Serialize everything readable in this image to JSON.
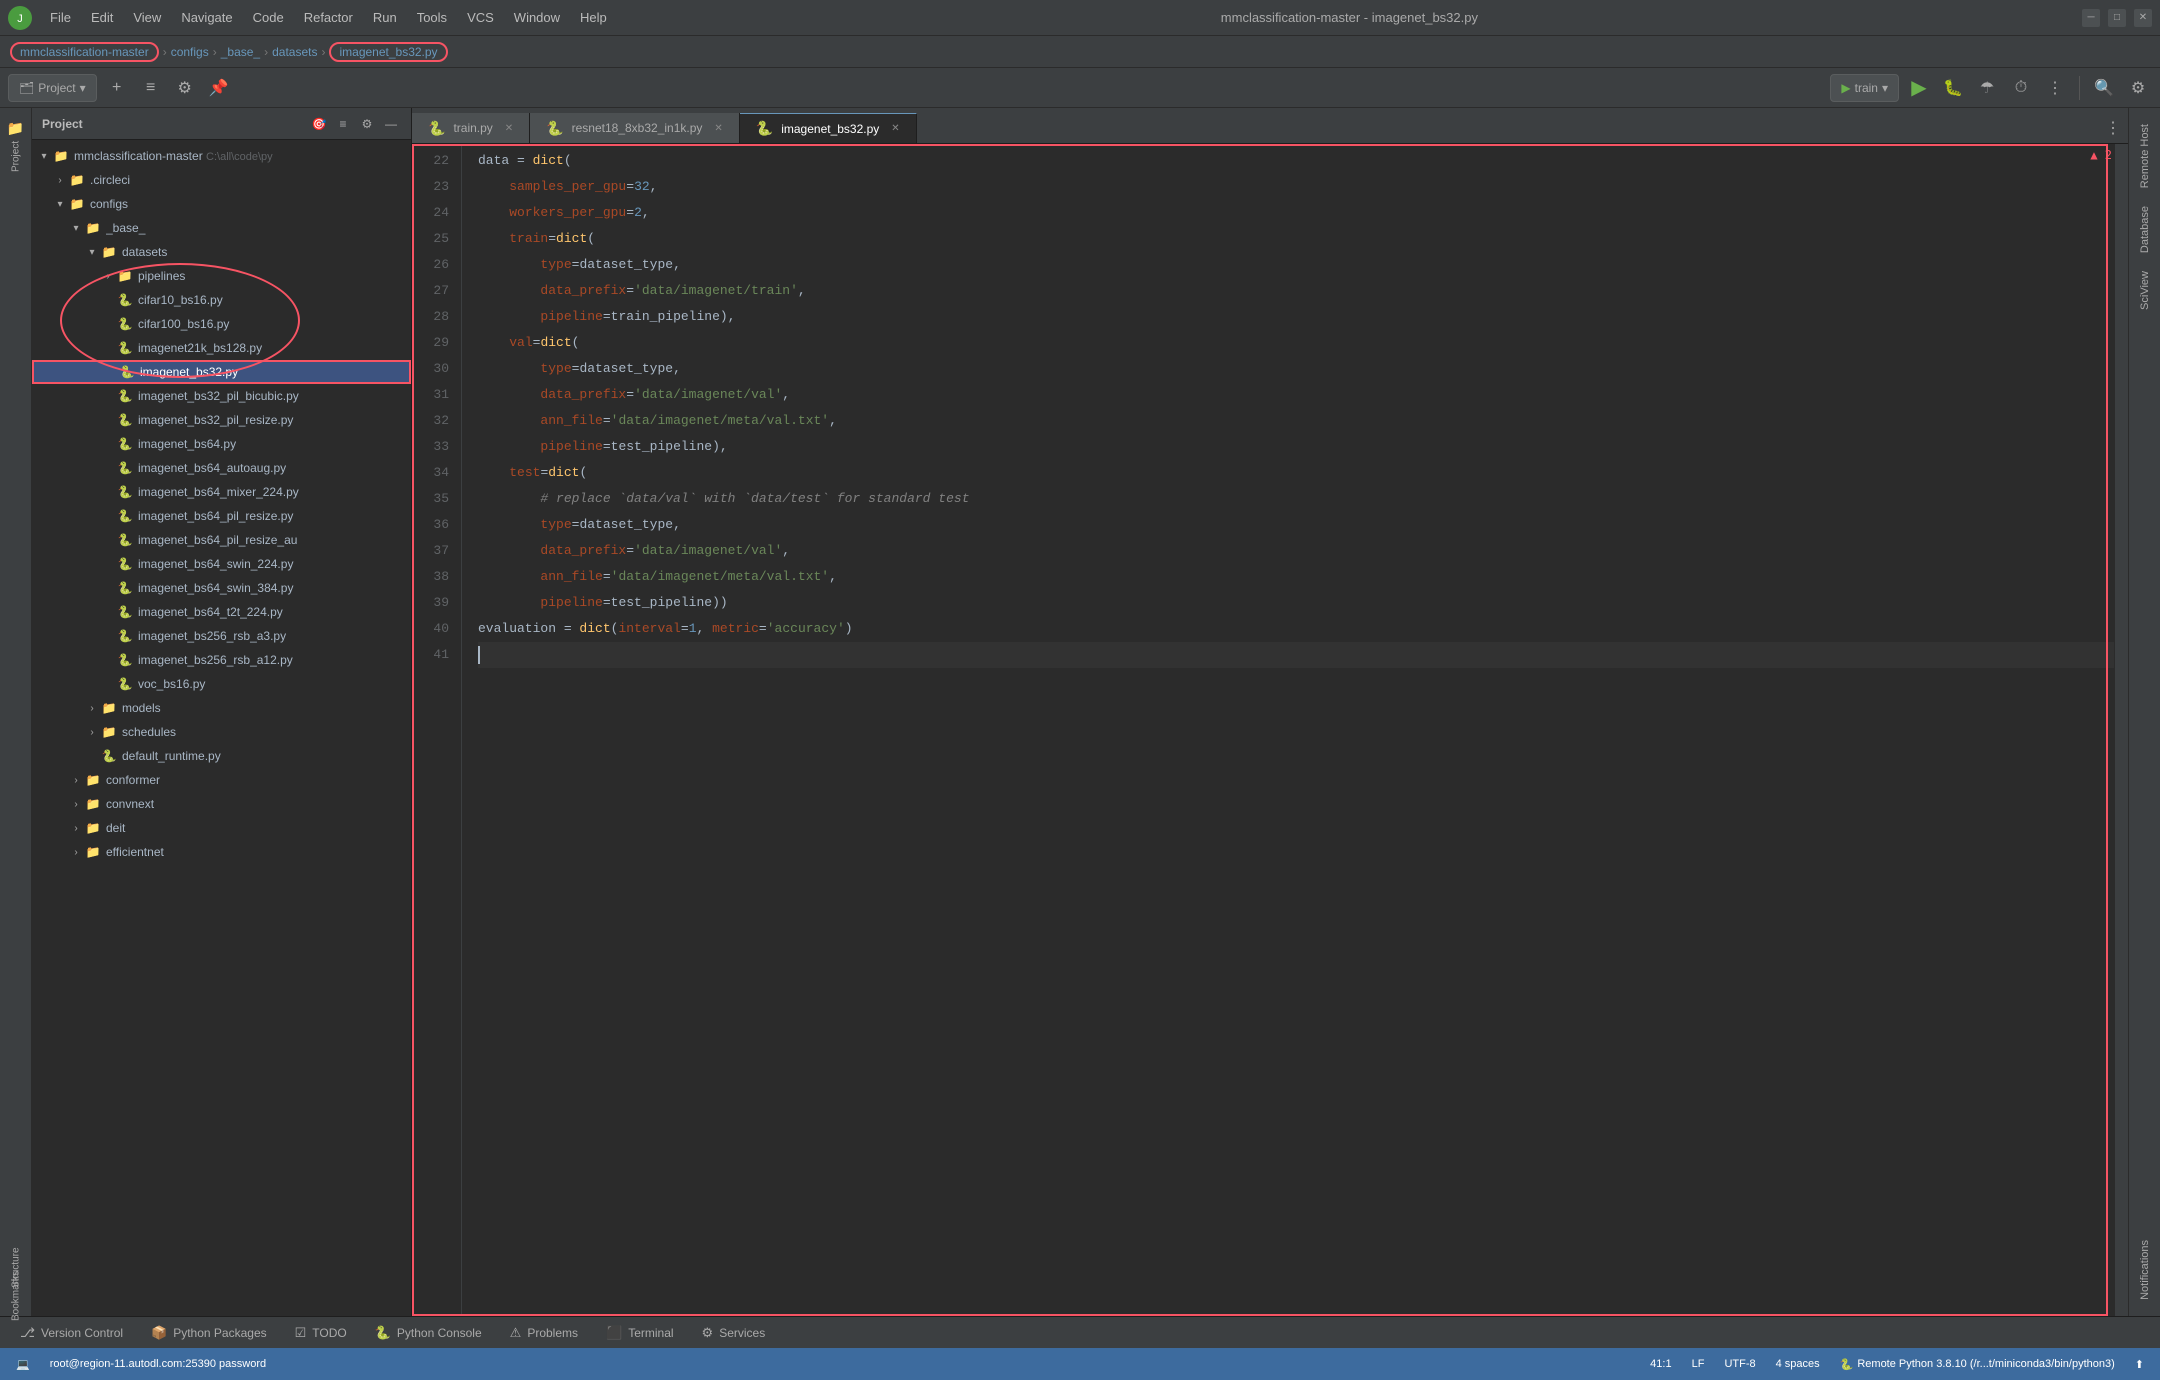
{
  "app": {
    "title": "mmclassification-master - imagenet_bs32.py",
    "icon": "🐍"
  },
  "menu": {
    "items": [
      "File",
      "Edit",
      "View",
      "Navigate",
      "Code",
      "Refactor",
      "Run",
      "Tools",
      "VCS",
      "Window",
      "Help"
    ]
  },
  "breadcrumb": {
    "items": [
      "mmclassification-master",
      "configs",
      "_base_",
      "datasets",
      "imagenet_bs32.py"
    ]
  },
  "toolbar": {
    "project_label": "Project",
    "run_config": "train",
    "run_label": "train"
  },
  "tabs": {
    "items": [
      {
        "label": "train.py",
        "active": false
      },
      {
        "label": "resnet18_8xb32_in1k.py",
        "active": false
      },
      {
        "label": "imagenet_bs32.py",
        "active": true
      }
    ]
  },
  "file_tree": {
    "root": "mmclassification-master",
    "root_path": "C:\\all\\code\\py",
    "items": [
      {
        "label": ".circleci",
        "type": "folder",
        "indent": 1,
        "expanded": false
      },
      {
        "label": "configs",
        "type": "folder",
        "indent": 1,
        "expanded": true
      },
      {
        "label": "_base_",
        "type": "folder",
        "indent": 2,
        "expanded": true
      },
      {
        "label": "datasets",
        "type": "folder",
        "indent": 3,
        "expanded": true
      },
      {
        "label": "pipelines",
        "type": "folder",
        "indent": 4,
        "expanded": false
      },
      {
        "label": "cifar10_bs16.py",
        "type": "py",
        "indent": 4
      },
      {
        "label": "cifar100_bs16.py",
        "type": "py",
        "indent": 4
      },
      {
        "label": "imagenet21k_bs128.py",
        "type": "py",
        "indent": 4
      },
      {
        "label": "imagenet_bs32.py",
        "type": "py",
        "indent": 4,
        "selected": true
      },
      {
        "label": "imagenet_bs32_pil_bicubic.py",
        "type": "py",
        "indent": 4
      },
      {
        "label": "imagenet_bs32_pil_resize.py",
        "type": "py",
        "indent": 4
      },
      {
        "label": "imagenet_bs64.py",
        "type": "py",
        "indent": 4
      },
      {
        "label": "imagenet_bs64_autoaug.py",
        "type": "py",
        "indent": 4
      },
      {
        "label": "imagenet_bs64_mixer_224.py",
        "type": "py",
        "indent": 4
      },
      {
        "label": "imagenet_bs64_pil_resize.py",
        "type": "py",
        "indent": 4
      },
      {
        "label": "imagenet_bs64_pil_resize_au",
        "type": "py",
        "indent": 4
      },
      {
        "label": "imagenet_bs64_swin_224.py",
        "type": "py",
        "indent": 4
      },
      {
        "label": "imagenet_bs64_swin_384.py",
        "type": "py",
        "indent": 4
      },
      {
        "label": "imagenet_bs64_t2t_224.py",
        "type": "py",
        "indent": 4
      },
      {
        "label": "imagenet_bs256_rsb_a3.py",
        "type": "py",
        "indent": 4
      },
      {
        "label": "imagenet_bs256_rsb_a12.py",
        "type": "py",
        "indent": 4
      },
      {
        "label": "voc_bs16.py",
        "type": "py",
        "indent": 4
      },
      {
        "label": "models",
        "type": "folder",
        "indent": 3,
        "expanded": false
      },
      {
        "label": "schedules",
        "type": "folder",
        "indent": 3,
        "expanded": false
      },
      {
        "label": "default_runtime.py",
        "type": "py",
        "indent": 3
      },
      {
        "label": "conformer",
        "type": "folder",
        "indent": 2,
        "expanded": false
      },
      {
        "label": "convnext",
        "type": "folder",
        "indent": 2,
        "expanded": false
      },
      {
        "label": "deit",
        "type": "folder",
        "indent": 2,
        "expanded": false
      },
      {
        "label": "efficientnet",
        "type": "folder",
        "indent": 2,
        "expanded": false
      }
    ]
  },
  "code": {
    "lines": [
      {
        "num": 22,
        "content": "data = dict("
      },
      {
        "num": 23,
        "content": "    samples_per_gpu=32,"
      },
      {
        "num": 24,
        "content": "    workers_per_gpu=2,"
      },
      {
        "num": 25,
        "content": "    train=dict("
      },
      {
        "num": 26,
        "content": "        type=dataset_type,"
      },
      {
        "num": 27,
        "content": "        data_prefix='data/imagenet/train',"
      },
      {
        "num": 28,
        "content": "        pipeline=train_pipeline),"
      },
      {
        "num": 29,
        "content": "    val=dict("
      },
      {
        "num": 30,
        "content": "        type=dataset_type,"
      },
      {
        "num": 31,
        "content": "        data_prefix='data/imagenet/val',"
      },
      {
        "num": 32,
        "content": "        ann_file='data/imagenet/meta/val.txt',"
      },
      {
        "num": 33,
        "content": "        pipeline=test_pipeline),"
      },
      {
        "num": 34,
        "content": "    test=dict("
      },
      {
        "num": 35,
        "content": "        # replace `data/val` with `data/test` for standard test"
      },
      {
        "num": 36,
        "content": "        type=dataset_type,"
      },
      {
        "num": 37,
        "content": "        data_prefix='data/imagenet/val',"
      },
      {
        "num": 38,
        "content": "        ann_file='data/imagenet/meta/val.txt',"
      },
      {
        "num": 39,
        "content": "        pipeline=test_pipeline))"
      },
      {
        "num": 40,
        "content": "evaluation = dict(interval=1, metric='accuracy')"
      },
      {
        "num": 41,
        "content": ""
      }
    ]
  },
  "bottom_tabs": [
    {
      "label": "Version Control",
      "icon": "⎇",
      "active": false
    },
    {
      "label": "Python Packages",
      "icon": "📦",
      "active": false
    },
    {
      "label": "TODO",
      "icon": "☑",
      "active": false
    },
    {
      "label": "Python Console",
      "icon": "🐍",
      "active": false
    },
    {
      "label": "Problems",
      "icon": "⚠",
      "active": false
    },
    {
      "label": "Terminal",
      "icon": "⬛",
      "active": false
    },
    {
      "label": "Services",
      "icon": "⚙",
      "active": false
    }
  ],
  "status_bar": {
    "connection": "root@region-11.autodl.com:25390 password",
    "position": "41:1",
    "encoding": "UTF-8",
    "line_ending": "LF",
    "indent": "4 spaces",
    "python": "Remote Python 3.8.10 (/r...t/miniconda3/bin/python3)"
  },
  "right_sidebar": {
    "items": [
      "Remote Host",
      "Database",
      "SciView",
      "Notifications"
    ]
  },
  "annotation": {
    "error_count": "▲ 2"
  }
}
